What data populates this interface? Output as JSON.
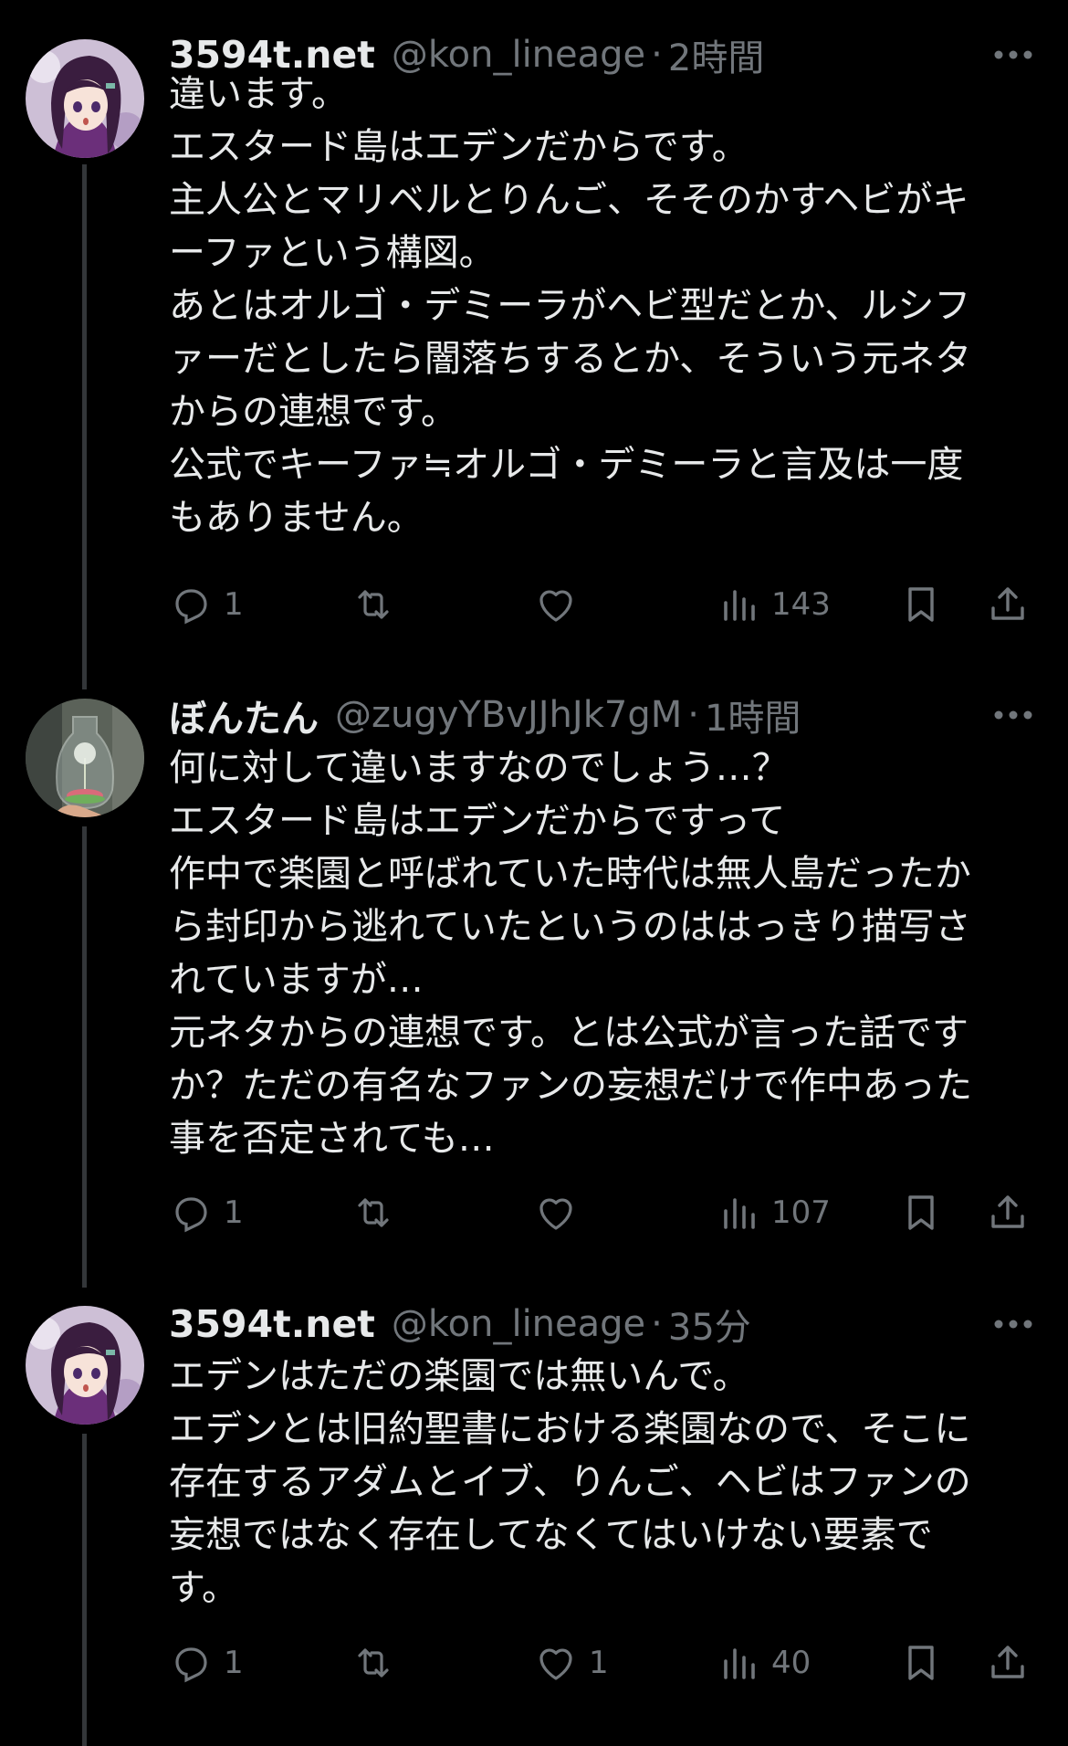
{
  "tweets": [
    {
      "name": "3594t.net",
      "handle": "@kon_lineage",
      "dot": "·",
      "time": "2時間",
      "lines": [
        "違います。",
        "エスタード島はエデンだからです。",
        "主人公とマリベルとりんご、そそのかすヘビがキ",
        "ーファという構図。",
        "あとはオルゴ・デミーラがヘビ型だとか、ルシフ",
        "ァーだとしたら闇落ちするとか、そういう元ネタ",
        "からの連想です。",
        "公式でキーファ≒オルゴ・デミーラと言及は一度",
        "もありません。"
      ],
      "replies": "1",
      "retweets": "",
      "likes": "",
      "views": "143",
      "avatar": "purple-haired-anime-girl"
    },
    {
      "name": "ぼんたん",
      "handle": "@zugyYBvJJhJk7gM",
      "dot": "·",
      "time": "1時間",
      "lines": [
        "何に対して違いますなのでしょう…？",
        "エスタード島はエデンだからですって",
        "作中で楽園と呼ばれていた時代は無人島だったか",
        "ら封印から逃れていたというのははっきり描写さ",
        "れていますが…",
        "元ネタからの連想です。とは公式が言った話です",
        "か？ただの有名なファンの妄想だけで作中あった",
        "事を否定されても…"
      ],
      "replies": "1",
      "retweets": "",
      "likes": "",
      "views": "107",
      "avatar": "dandelion-in-glass-bottle"
    },
    {
      "name": "3594t.net",
      "handle": "@kon_lineage",
      "dot": "·",
      "time": "35分",
      "lines": [
        "エデンはただの楽園では無いんで。",
        "エデンとは旧約聖書における楽園なので、そこに",
        "存在するアダムとイブ、りんご、ヘビはファンの",
        "妄想ではなく存在してなくてはいけない要素で",
        "す。"
      ],
      "replies": "1",
      "retweets": "",
      "likes": "1",
      "views": "40",
      "avatar": "purple-haired-anime-girl"
    }
  ],
  "colors": {
    "background": "#000000",
    "text": "#e7e9ea",
    "muted": "#71767b",
    "thread": "#333639"
  }
}
